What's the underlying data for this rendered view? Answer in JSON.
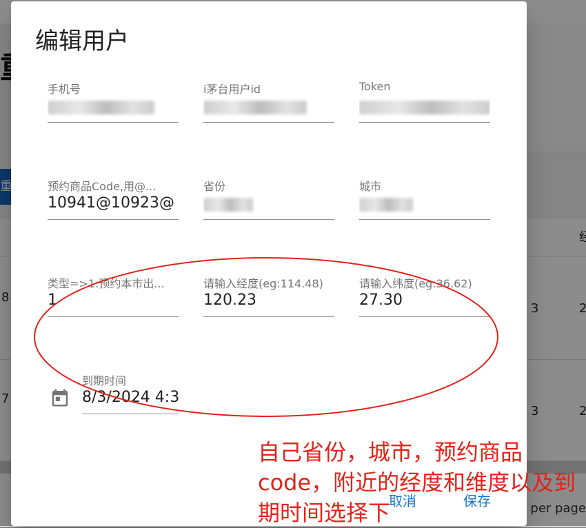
{
  "background": {
    "title_glyph": "重",
    "blue_button_glyph": "重",
    "header_glyph": "经",
    "row1": {
      "left": "8",
      "right_a": "3",
      "right_b": "2"
    },
    "row2": {
      "left": "7",
      "right_a": "3",
      "right_b": "2"
    },
    "footer_text": "s per page"
  },
  "dialog": {
    "title": "编辑用户",
    "fields": {
      "phone": {
        "label": "手机号",
        "value": ""
      },
      "user_id": {
        "label": "i茅台用户id",
        "value": ""
      },
      "token": {
        "label": "Token",
        "value": ""
      },
      "product_code": {
        "label": "预约商品Code,用@...",
        "value": "10941@10923@"
      },
      "province": {
        "label": "省份",
        "value": ""
      },
      "city": {
        "label": "城市",
        "value": ""
      },
      "type": {
        "label": "类型=>1:预约本市出...",
        "value": "1"
      },
      "longitude": {
        "label": "请输入经度(eg:114.48)",
        "value": "120.23"
      },
      "latitude": {
        "label": "请输入纬度(eg:36.62)",
        "value": "27.30"
      },
      "expire": {
        "label": "到期时间",
        "value": "8/3/2024 4:3"
      }
    },
    "actions": {
      "cancel": "取消",
      "save": "保存"
    }
  },
  "annotation": {
    "text": "自己省份，城市，预约商品code，附近的经度和维度以及到期时间选择下",
    "color": "#e2231a"
  }
}
